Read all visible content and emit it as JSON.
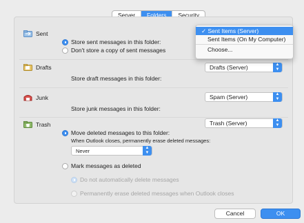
{
  "tabs": [
    {
      "label": "Server",
      "active": false
    },
    {
      "label": "Folders",
      "active": true
    },
    {
      "label": "Security",
      "active": false
    }
  ],
  "sections": {
    "sent": {
      "label": "Sent",
      "icon": "sent-folder-icon",
      "option_store": "Store sent messages in this folder:",
      "option_dont": "Don't store a copy of sent messages"
    },
    "drafts": {
      "label": "Drafts",
      "icon": "drafts-folder-icon",
      "description": "Store draft messages in this folder:",
      "select_value": "Drafts (Server)"
    },
    "junk": {
      "label": "Junk",
      "icon": "junk-folder-icon",
      "description": "Store junk messages in this folder:",
      "select_value": "Spam (Server)"
    },
    "trash": {
      "label": "Trash",
      "icon": "trash-folder-icon",
      "select_value": "Trash (Server)",
      "option_move": "Move deleted messages to this folder:",
      "close_note": "When Outlook closes, permanently erase deleted messages:",
      "erase_select_value": "Never",
      "option_mark": "Mark messages as deleted",
      "option_no_auto": "Do not automatically delete messages",
      "option_erase_close": "Permanently erase deleted messages when Outlook closes"
    }
  },
  "dropdown": {
    "items": [
      {
        "label": "Sent Items (Server)",
        "selected": true
      },
      {
        "label": "Sent Items (On My Computer)",
        "selected": false
      }
    ],
    "choose_label": "Choose..."
  },
  "buttons": {
    "cancel": "Cancel",
    "ok": "OK"
  },
  "colors": {
    "accent": "#3d8ff0"
  }
}
